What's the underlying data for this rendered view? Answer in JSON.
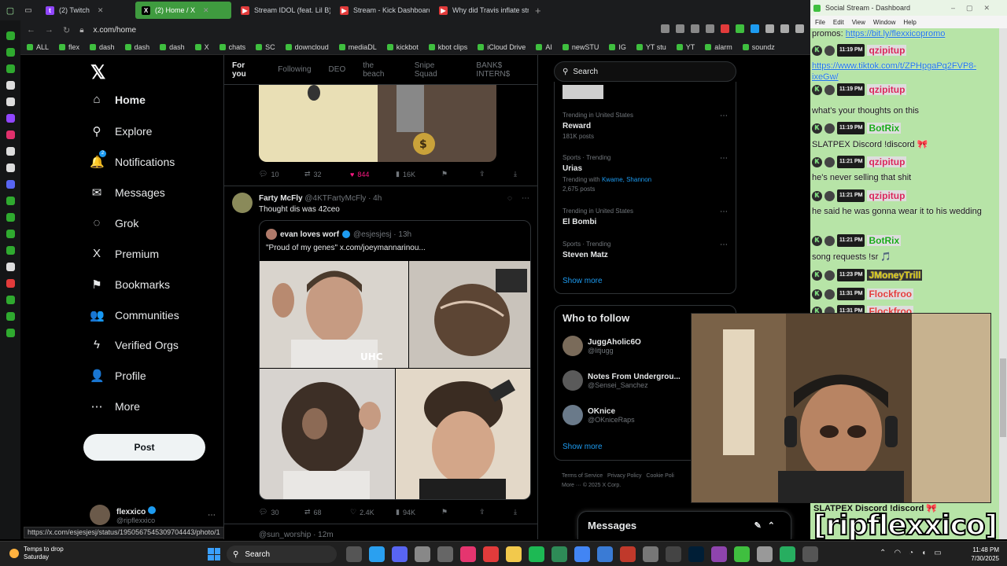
{
  "browser": {
    "tabs": [
      {
        "label": "(2) Twitch",
        "color": "#9146ff",
        "glyph": "t"
      },
      {
        "label": "(2) Home / X",
        "color": "#000000",
        "glyph": "X",
        "active": true
      },
      {
        "label": "Stream IDOL (feat. Lil B)",
        "color": "#e23b3b",
        "glyph": "▶"
      },
      {
        "label": "Stream - Kick Dashboard",
        "color": "#e23b3b",
        "glyph": "▶"
      },
      {
        "label": "Why did Travis inflate stre",
        "color": "#e23b3b",
        "glyph": "▶"
      }
    ],
    "new_tab": "+",
    "url": "x.com/home",
    "bookmarks": [
      "ALL",
      "flex",
      "dash",
      "dash",
      "dash",
      "X",
      "chats",
      "SC",
      "downcloud",
      "mediaDL",
      "kickbot",
      "kbot clips",
      "iCloud Drive",
      "AI",
      "newSTU",
      "IG",
      "YT stu",
      "YT",
      "alarm",
      "soundz"
    ]
  },
  "x": {
    "nav": [
      {
        "label": "Home",
        "icon": "home-icon",
        "glyph": "⌂"
      },
      {
        "label": "Explore",
        "icon": "search-icon",
        "glyph": "⚲"
      },
      {
        "label": "Notifications",
        "icon": "bell-icon",
        "glyph": "🔔"
      },
      {
        "label": "Messages",
        "icon": "envelope-icon",
        "glyph": "✉"
      },
      {
        "label": "Grok",
        "icon": "grok-icon",
        "glyph": "◌"
      },
      {
        "label": "Premium",
        "icon": "x-premium-icon",
        "glyph": "X"
      },
      {
        "label": "Bookmarks",
        "icon": "bookmark-icon",
        "glyph": "⚑"
      },
      {
        "label": "Communities",
        "icon": "communities-icon",
        "glyph": "👥"
      },
      {
        "label": "Verified Orgs",
        "icon": "bolt-icon",
        "glyph": "ϟ"
      },
      {
        "label": "Profile",
        "icon": "person-icon",
        "glyph": "👤"
      },
      {
        "label": "More",
        "icon": "more-icon",
        "glyph": "⋯"
      }
    ],
    "notif_badge": "2",
    "post_label": "Post",
    "account": {
      "name": "flexxico",
      "handle": "@ripflexxico"
    },
    "feed_tabs": [
      "For you",
      "Following",
      "DEO",
      "the beach",
      "Snipe Squad",
      "BANK$ INTERN$"
    ],
    "prev_actions": {
      "replies": "10",
      "reposts": "32",
      "likes": "844",
      "views": "16K"
    },
    "tweet": {
      "name": "Farty McFly",
      "handle": "@4KTFartyMcFly · 4h",
      "text": "Thought dis was 42ceo",
      "quote": {
        "name": "evan loves worf",
        "handle": "@esjesjesj · 13h",
        "text": "\"Proud of my genes\" x.com/joeymannarinou..."
      },
      "watermark": "UHC",
      "actions": {
        "replies": "30",
        "reposts": "68",
        "likes": "2.4K",
        "views": "94K"
      }
    },
    "next_tweet": "@sun_worship · 12m",
    "search_placeholder": "Search",
    "trends": [
      {
        "context": "Trending in United States",
        "name": "Reward",
        "posts": "181K posts"
      },
      {
        "context": "Sports · Trending",
        "name": "Urias",
        "with_label": "Trending with",
        "with_links": "Kwame, Shannon",
        "posts": "2,675 posts"
      },
      {
        "context": "Trending in United States",
        "name": "El Bombi"
      },
      {
        "context": "Sports · Trending",
        "name": "Steven Matz"
      }
    ],
    "show_more": "Show more",
    "who_to_follow": {
      "title": "Who to follow",
      "accounts": [
        {
          "name": "JuggAholic6O",
          "handle": "@litjugg"
        },
        {
          "name": "Notes From Undergrou...",
          "handle": "@Sensei_Sanchez"
        },
        {
          "name": "OKnice",
          "handle": "@OKniceRaps"
        }
      ],
      "show_more": "Show more"
    },
    "footer": {
      "terms": "Terms of Service",
      "privacy": "Privacy Policy",
      "cookie": "Cookie Poli",
      "more": "More ···",
      "copyright": "© 2025 X Corp."
    },
    "messages": "Messages",
    "status_url": "https://x.com/esjesjesj/status/1950567545309704443/photo/1"
  },
  "social": {
    "title": "Social Stream - Dashboard",
    "menu": [
      "File",
      "Edit",
      "View",
      "Window",
      "Help"
    ],
    "lines": [
      {
        "type": "text",
        "text": "promos: ",
        "link": "https://bit.ly/flexxicopromo"
      },
      {
        "type": "head",
        "time": "11:19 PM",
        "user": "qzipitup",
        "style": "pink"
      },
      {
        "type": "link",
        "text": "https://www.tiktok.com/t/ZPHpgaPq2FVP8-ixeGw/"
      },
      {
        "type": "head",
        "time": "11:19 PM",
        "user": "qzipitup",
        "style": "pink"
      },
      {
        "type": "text",
        "text": "what's your thoughts on this"
      },
      {
        "type": "head",
        "time": "11:19 PM",
        "user": "BotRix",
        "style": "green"
      },
      {
        "type": "text",
        "text": "SLATPEX Discord !discord 🎀"
      },
      {
        "type": "head",
        "time": "11:21 PM",
        "user": "qzipitup",
        "style": "pink"
      },
      {
        "type": "text",
        "text": "he's never selling that shit"
      },
      {
        "type": "head",
        "time": "11:21 PM",
        "user": "qzipitup",
        "style": "pink"
      },
      {
        "type": "text",
        "text": "he said he was gonna wear it to his wedding"
      },
      {
        "type": "head",
        "time": "11:21 PM",
        "user": "BotRix",
        "style": "green"
      },
      {
        "type": "text",
        "text": "song requests !sr 🎵"
      },
      {
        "type": "head",
        "time": "11:23 PM",
        "user": "JMoneyTrill",
        "style": "yellow"
      },
      {
        "type": "head",
        "time": "11:31 PM",
        "user": "Flockfroo",
        "style": "red"
      },
      {
        "type": "head",
        "time": "11:31 PM",
        "user": "Flockfroo",
        "style": "red"
      }
    ],
    "overlay_text": "SLATPEX Discord !discord 🎀",
    "overlay_name": "[ripflexxico]"
  },
  "taskbar": {
    "weather_title": "Temps to drop",
    "weather_sub": "Saturday",
    "search": "Search",
    "time": "11:48 PM",
    "date": "7/30/2025"
  }
}
